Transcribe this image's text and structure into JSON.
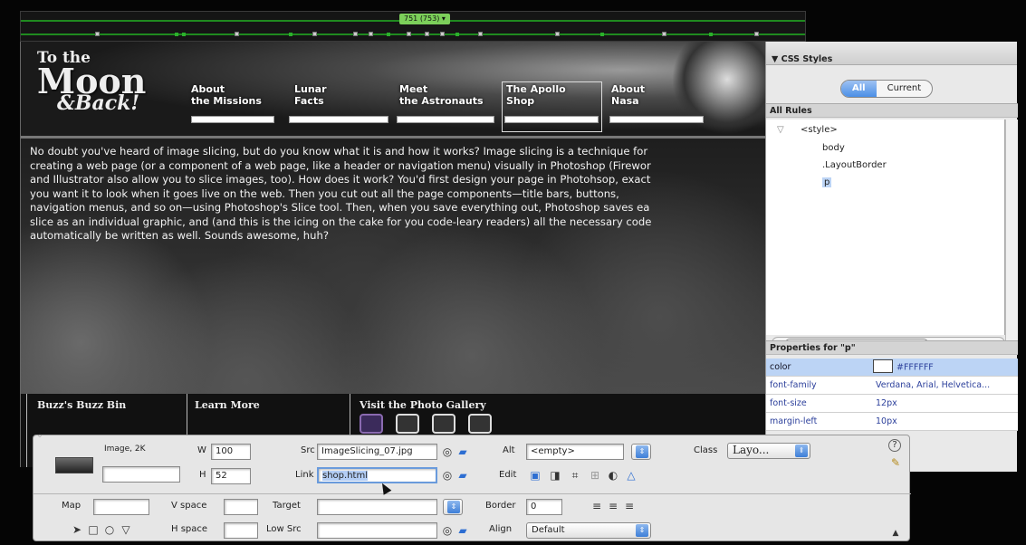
{
  "ruler": {
    "width_label": "751 (753) ▾"
  },
  "header": {
    "logo": {
      "line1": "To the",
      "line2": "Moon",
      "line3": "&Back!"
    },
    "nav": [
      {
        "line1": "About",
        "line2": "the Missions"
      },
      {
        "line1": "Lunar",
        "line2": "Facts"
      },
      {
        "line1": "Meet",
        "line2": "the Astronauts"
      },
      {
        "line1": "The Apollo",
        "line2": "Shop"
      },
      {
        "line1": "About",
        "line2": "Nasa"
      }
    ]
  },
  "content": {
    "lines": [
      "No doubt you've heard of image slicing, but do you know what it is and how it works? Image slicing is a technique for",
      "creating a web page (or a component of a web page, like a header or navigation menu) visually in Photoshop (Firewor",
      "and Illustrator also allow you to slice images, too). How does it work? You'd first design your page in Photohsop, exact",
      "you want it to look when it goes live on the web. Then you cut out all the page components—title bars, buttons,",
      "navigation menus, and so on—using Photoshop's Slice tool. Then, when you save everything out, Photoshop saves ea",
      "slice as an individual graphic, and (and this is the icing on the cake for you code-leary readers) all the necessary code",
      "automatically be written as well. Sounds awesome, huh?"
    ]
  },
  "footer": {
    "col1": "Buzz's Buzz Bin",
    "col2": "Learn More",
    "col3": "Visit the Photo Gallery"
  },
  "css_panel": {
    "title": "▼ CSS Styles",
    "tab_all": "All",
    "tab_current": "Current",
    "all_rules_header": "All Rules",
    "rules": [
      "<style>",
      "body",
      ".LayoutBorder",
      "p"
    ],
    "properties_header": "Properties for \"p\"",
    "properties": [
      {
        "name": "color",
        "value": "#FFFFFF"
      },
      {
        "name": "font-family",
        "value": "Verdana, Arial, Helvetica..."
      },
      {
        "name": "font-size",
        "value": "12px"
      },
      {
        "name": "margin-left",
        "value": "10px"
      }
    ]
  },
  "inspector": {
    "image_label": "Image, 2K",
    "w_label": "W",
    "w_value": "100",
    "h_label": "H",
    "h_value": "52",
    "src_label": "Src",
    "src_value": "ImageSlicing_07.jpg",
    "link_label": "Link",
    "link_value": "shop.html",
    "alt_label": "Alt",
    "alt_value": "<empty>",
    "edit_label": "Edit",
    "class_label": "Class",
    "class_value": "Layo...",
    "map_label": "Map",
    "vspace_label": "V space",
    "target_label": "Target",
    "border_label": "Border",
    "border_value": "0",
    "hspace_label": "H space",
    "lowsrc_label": "Low Src",
    "align_label": "Align",
    "align_value": "Default"
  },
  "colors": {
    "ruler_green": "#1f8a1f",
    "selection_blue": "#bcd4f5",
    "accent_blue": "#4b8fe6"
  }
}
